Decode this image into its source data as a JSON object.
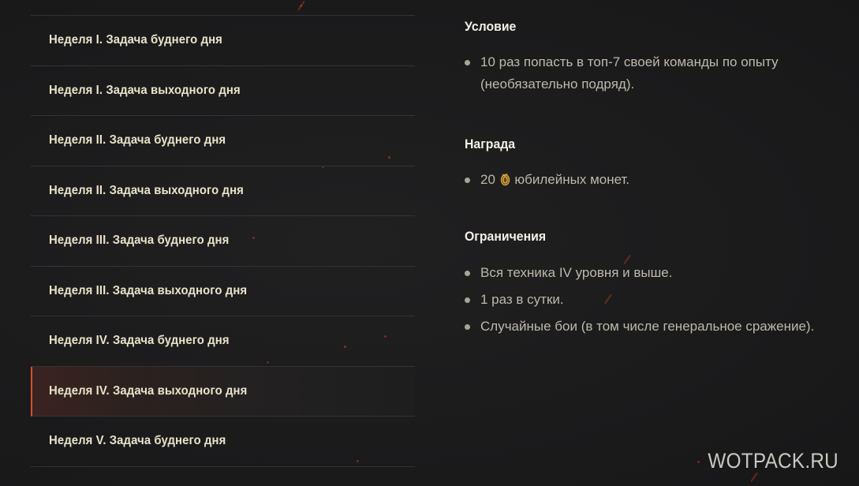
{
  "task_list": {
    "items": [
      {
        "label": "Неделя I. Задача буднего дня",
        "active": false
      },
      {
        "label": "Неделя I. Задача выходного дня",
        "active": false
      },
      {
        "label": "Неделя II. Задача буднего дня",
        "active": false
      },
      {
        "label": "Неделя II. Задача выходного дня",
        "active": false
      },
      {
        "label": "Неделя III. Задача буднего дня",
        "active": false
      },
      {
        "label": "Неделя III. Задача выходного дня",
        "active": false
      },
      {
        "label": "Неделя IV. Задача буднего дня",
        "active": false
      },
      {
        "label": "Неделя IV. Задача выходного дня",
        "active": true
      },
      {
        "label": "Неделя V. Задача буднего дня",
        "active": false
      }
    ]
  },
  "details": {
    "condition": {
      "title": "Условие",
      "items": [
        "10 раз попасть в топ-7 своей команды по опыту (необязательно подряд)."
      ]
    },
    "reward": {
      "title": "Награда",
      "amount": "20",
      "text": "юбилейных монет.",
      "icon": "coin-icon"
    },
    "restrictions": {
      "title": "Ограничения",
      "items": [
        "Вся техника IV уровня и выше.",
        "1 раз в сутки.",
        "Случайные бои (в том числе генеральное сражение)."
      ]
    }
  },
  "watermark": "WOTPACK.RU",
  "colors": {
    "accent": "#d4502c",
    "list_text": "#e9e3c9",
    "body_text": "#bdb9ac",
    "background": "#1b1b1c"
  }
}
